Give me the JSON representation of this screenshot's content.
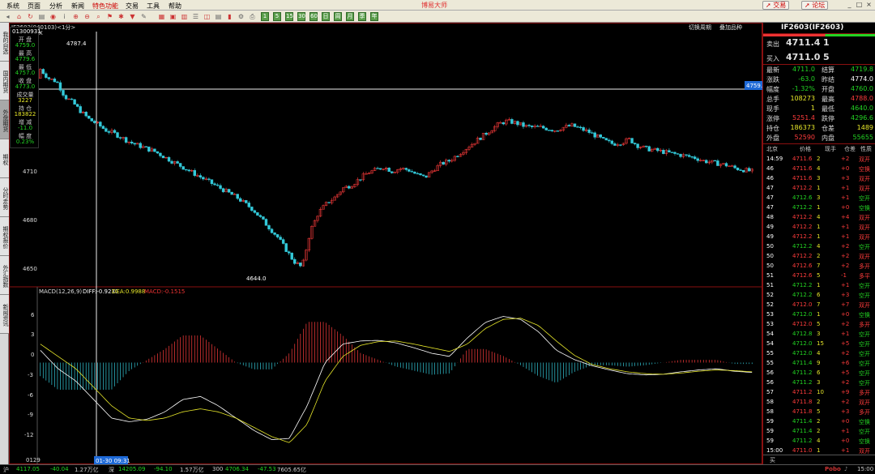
{
  "menu": {
    "items": [
      "系统",
      "页面",
      "分析",
      "新闻",
      "特色功能",
      "交易",
      "工具",
      "帮助"
    ],
    "title": "博易大师",
    "trade_btn": "交易",
    "forum_btn": "论坛"
  },
  "toolbar": {
    "num_buttons": [
      "1",
      "5",
      "15",
      "30",
      "60",
      "日",
      "周",
      "月",
      "季",
      "年"
    ]
  },
  "left_tabs": [
    "我的自选",
    "国内期货",
    "外盘期货",
    "期权",
    "分时走势",
    "期权报价",
    "外汇指数",
    "新闻资讯"
  ],
  "chart": {
    "header_label": "IF2603(040103)<1分>",
    "right_links": [
      "切换周期",
      "叠加品种"
    ],
    "marker_x": "X",
    "cursor_price_label": "4759.0",
    "time_axis_left": "0129",
    "time_cursor_label": "01-30 09:31",
    "y_ticks_main": [
      "4710",
      "4680",
      "4650"
    ],
    "y_ticks_macd": [
      "6",
      "3",
      "0",
      "-3",
      "-6",
      "-9",
      "-12"
    ],
    "high_label": "4787.4",
    "low_label": "4644.0",
    "macd_title": "MACD(12,26,9)",
    "macd_diff": "DIFF:-0.9231",
    "macd_dea": "DEA:0.9988",
    "macd_value": "MACD:-0.1515",
    "colors": {
      "up": "#ff3c3c",
      "down": "#33c9d9",
      "diff": "#ffffff",
      "dea": "#e7e72a"
    },
    "data_box": {
      "time": "01300931",
      "rows": [
        [
          "开 盘",
          "4759.0"
        ],
        [
          "最 高",
          "4779.6"
        ],
        [
          "最 低",
          "4757.0"
        ],
        [
          "收 盘",
          "4773.0"
        ],
        [
          "成交量",
          "3227"
        ],
        [
          "持 仓",
          "183822"
        ],
        [
          "增 减",
          "-11.0"
        ],
        [
          "幅 度",
          "0.23%"
        ]
      ]
    }
  },
  "chart_data": {
    "type": "candlestick",
    "ylim": [
      4638,
      4800
    ],
    "high": 4787.4,
    "low": 4644.0,
    "close_path": [
      4778,
      4772,
      4770,
      4760,
      4756,
      4750,
      4745,
      4742,
      4738,
      4736,
      4733,
      4730,
      4728,
      4726,
      4724,
      4721,
      4718,
      4715,
      4712,
      4709,
      4706,
      4703,
      4700,
      4697,
      4694,
      4690,
      4686,
      4680,
      4674,
      4668,
      4660,
      4652,
      4648,
      4672,
      4684,
      4690,
      4694,
      4700,
      4702,
      4706,
      4710,
      4712,
      4714,
      4711,
      4713,
      4712,
      4709,
      4707,
      4712,
      4716,
      4718,
      4722,
      4726,
      4730,
      4734,
      4738,
      4742,
      4744,
      4743,
      4741,
      4740,
      4740,
      4739,
      4738,
      4740,
      4741,
      4739,
      4737,
      4734,
      4731,
      4729,
      4730,
      4732,
      4728,
      4726,
      4725,
      4724,
      4723,
      4722,
      4721,
      4720,
      4718,
      4717,
      4716,
      4715,
      4713,
      4712,
      4711
    ],
    "macd_diff_path": [
      2,
      -1,
      -3,
      -6,
      -9,
      -9.6,
      -9.2,
      -8,
      -6,
      -5.5,
      -7,
      -9,
      -11,
      -12.5,
      -12.3,
      -7,
      0,
      3,
      3.5,
      3.6,
      3.2,
      2.4,
      1.5,
      1.0,
      4,
      6.5,
      7.5,
      7,
      5,
      2,
      0.5,
      -0.5,
      -1.2,
      -1.8,
      -2,
      -1.9,
      -1.5,
      -1.2,
      -1.0,
      -1.4,
      -1.6
    ],
    "macd_dea_path": [
      3,
      1,
      -1,
      -4,
      -7,
      -9,
      -9.4,
      -9,
      -8,
      -7.5,
      -8,
      -9,
      -10.5,
      -12,
      -13,
      -10,
      -3,
      1,
      2.8,
      3.4,
      3.5,
      3,
      2.4,
      1.8,
      3,
      5.5,
      7,
      7.2,
      6,
      3.5,
      1.2,
      -0.3,
      -1,
      -1.5,
      -1.8,
      -1.9,
      -1.7,
      -1.4,
      -1.2,
      -1.3,
      -1.5
    ]
  },
  "quote": {
    "symbol": "IF2603(IF2603)",
    "sell_label": "卖出",
    "sell_price": "4711.4",
    "sell_vol": "1",
    "buy_label": "买入",
    "buy_price": "4711.0",
    "buy_vol": "5",
    "rows": [
      [
        "最新",
        "4711.0",
        "结算",
        "4719.8"
      ],
      [
        "涨跌",
        "-63.0",
        "昨结",
        "4774.0"
      ],
      [
        "幅度",
        "-1.32%",
        "开盘",
        "4760.0"
      ],
      [
        "总手",
        "108273",
        "最高",
        "4788.0"
      ],
      [
        "现手",
        "1",
        "最低",
        "4640.0"
      ],
      [
        "涨停",
        "5251.4",
        "跌停",
        "4296.6"
      ],
      [
        "持仓",
        "186373",
        "仓差",
        "1489"
      ],
      [
        "外盘",
        "52590",
        "内盘",
        "55655"
      ]
    ],
    "trade_headers": [
      "北京",
      "价格",
      "现手",
      "仓差",
      "性质"
    ]
  },
  "ticks": [
    [
      "14:59",
      "4711.6",
      "2",
      "+2",
      "双开"
    ],
    [
      "46",
      "4711.6",
      "4",
      "+0",
      "空换"
    ],
    [
      "46",
      "4711.6",
      "3",
      "+3",
      "双开"
    ],
    [
      "47",
      "4712.2",
      "1",
      "+1",
      "双开"
    ],
    [
      "47",
      "4712.6",
      "3",
      "+1",
      "空开"
    ],
    [
      "47",
      "4712.2",
      "1",
      "+0",
      "空换"
    ],
    [
      "48",
      "4712.2",
      "4",
      "+4",
      "双开"
    ],
    [
      "49",
      "4712.2",
      "1",
      "+1",
      "双开"
    ],
    [
      "49",
      "4712.2",
      "1",
      "+1",
      "双开"
    ],
    [
      "50",
      "4712.2",
      "4",
      "+2",
      "空开"
    ],
    [
      "50",
      "4712.2",
      "2",
      "+2",
      "双开"
    ],
    [
      "50",
      "4712.6",
      "7",
      "+2",
      "多开"
    ],
    [
      "51",
      "4712.6",
      "5",
      "-1",
      "多平"
    ],
    [
      "51",
      "4712.2",
      "1",
      "+1",
      "空开"
    ],
    [
      "52",
      "4712.2",
      "6",
      "+3",
      "空开"
    ],
    [
      "52",
      "4712.0",
      "7",
      "+7",
      "双开"
    ],
    [
      "53",
      "4712.0",
      "1",
      "+0",
      "空换"
    ],
    [
      "53",
      "4712.0",
      "5",
      "+2",
      "多开"
    ],
    [
      "54",
      "4712.8",
      "3",
      "+1",
      "空开"
    ],
    [
      "54",
      "4712.0",
      "15",
      "+5",
      "空开"
    ],
    [
      "55",
      "4712.0",
      "4",
      "+2",
      "空开"
    ],
    [
      "55",
      "4711.4",
      "9",
      "+6",
      "空开"
    ],
    [
      "56",
      "4711.2",
      "6",
      "+5",
      "空开"
    ],
    [
      "56",
      "4711.2",
      "3",
      "+2",
      "空开"
    ],
    [
      "57",
      "4711.2",
      "10",
      "+9",
      "多开"
    ],
    [
      "58",
      "4711.8",
      "2",
      "+2",
      "双开"
    ],
    [
      "58",
      "4711.8",
      "5",
      "+3",
      "多开"
    ],
    [
      "59",
      "4711.4",
      "2",
      "+0",
      "空换"
    ],
    [
      "59",
      "4711.4",
      "2",
      "+1",
      "空开"
    ],
    [
      "59",
      "4711.2",
      "4",
      "+0",
      "空换"
    ],
    [
      "15:00",
      "4711.0",
      "1",
      "+1",
      "双开"
    ]
  ],
  "tick_color_seq": [
    "up",
    "up",
    "up",
    "up",
    "dn",
    "dn",
    "up",
    "up",
    "up",
    "dn",
    "up",
    "up",
    "up",
    "dn",
    "dn",
    "up",
    "dn",
    "up",
    "dn",
    "dn",
    "dn",
    "dn",
    "dn",
    "dn",
    "up",
    "up",
    "up",
    "dn",
    "dn",
    "dn",
    "up"
  ],
  "right_footer": "买",
  "status": {
    "items": [
      [
        "沪",
        "4117.05",
        "-40.04",
        "1.27万亿"
      ],
      [
        "深",
        "14205.09",
        "-94.10",
        "1.57万亿"
      ],
      [
        "300",
        "4706.34",
        "-47.53",
        "7605.65亿"
      ]
    ],
    "logo": "Pobo",
    "clock": "15:00"
  }
}
